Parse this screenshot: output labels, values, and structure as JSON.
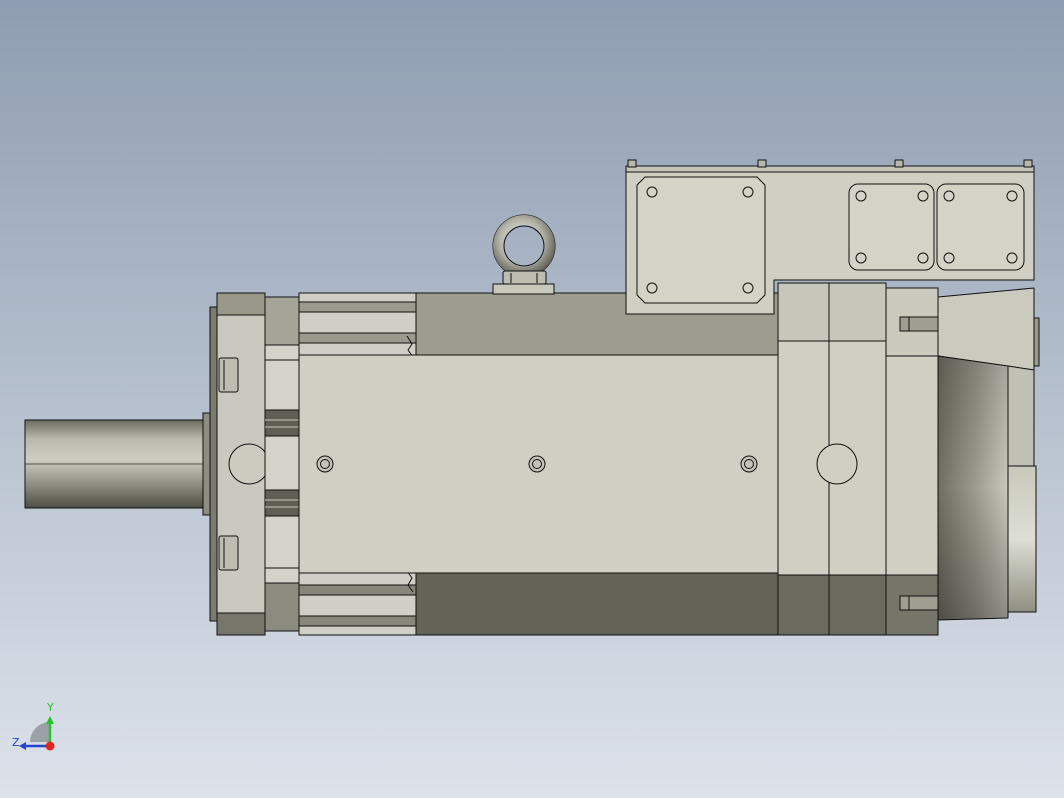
{
  "viewport": {
    "background_top": "#8e9db1",
    "background_bottom": "#dde2ea"
  },
  "model": {
    "body_fill": "#cfcfc4",
    "body_light": "#e2e2d8",
    "body_dark": "#656559",
    "outline": "#111111"
  },
  "triad": {
    "x_axis_color": "#e0261d",
    "y_axis_color": "#27c22c",
    "z_axis_color": "#2545c8",
    "y_label": "Y",
    "z_label": "Z"
  }
}
